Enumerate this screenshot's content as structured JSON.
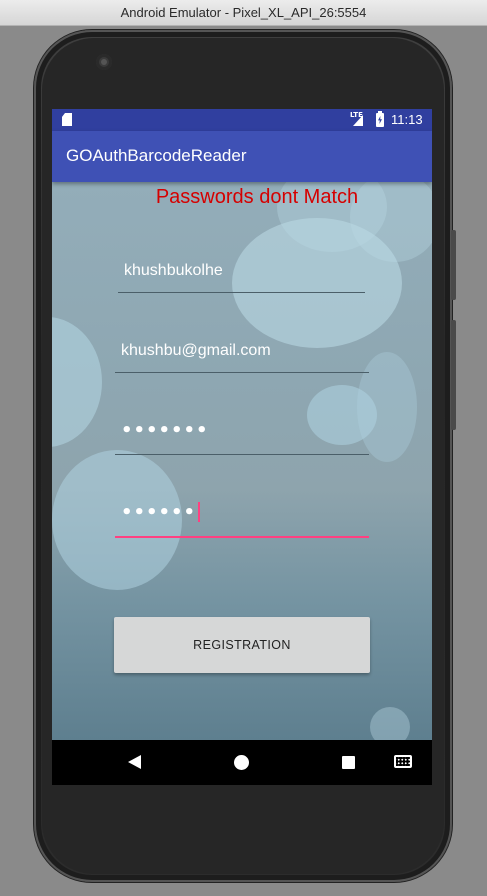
{
  "window": {
    "title": "Android Emulator - Pixel_XL_API_26:5554"
  },
  "status_bar": {
    "time": "11:13",
    "network_label": "LTE"
  },
  "app_bar": {
    "title": "GOAuthBarcodeReader"
  },
  "form": {
    "error_message": "Passwords dont Match",
    "username_value": "khushbukolhe",
    "email_value": "khushbu@gmail.com",
    "password_mask": "•••••••",
    "confirm_password_mask": "••••••",
    "register_label": "REGISTRATION"
  },
  "colors": {
    "status_bar": "#303f9f",
    "app_bar": "#3f51b5",
    "error_text": "#d50000",
    "focused_underline": "#ff4081",
    "button_bg": "#d6d7d7"
  },
  "nav_bar": {
    "icons": [
      "back-icon",
      "home-icon",
      "recents-icon",
      "keyboard-icon"
    ]
  }
}
